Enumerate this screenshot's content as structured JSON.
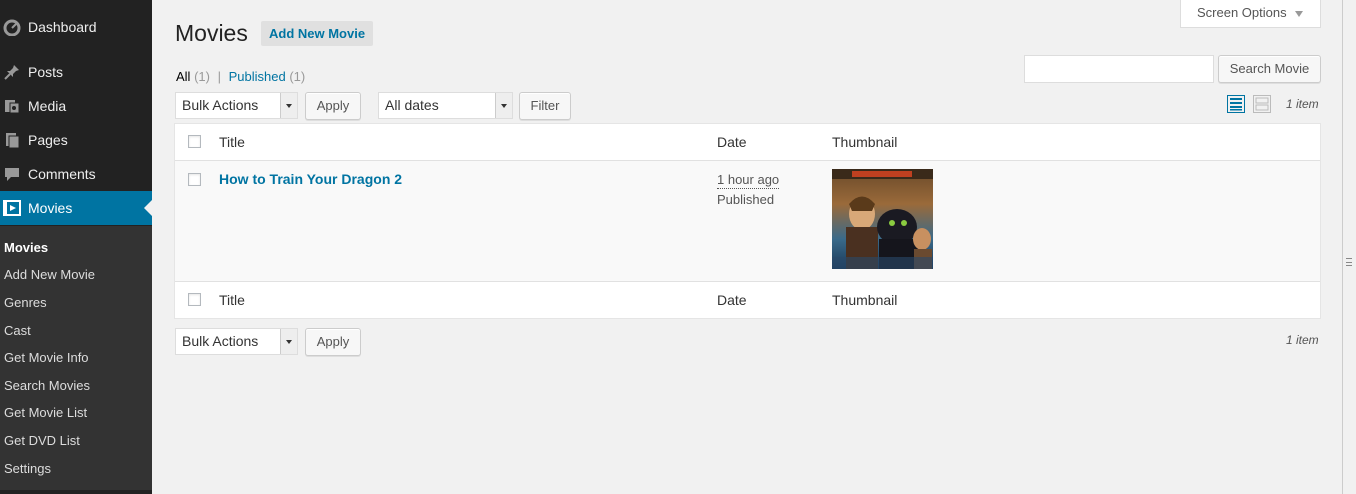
{
  "menu": {
    "items": [
      {
        "label": "Dashboard",
        "icon": "dashboard-icon"
      },
      {
        "label": "Posts",
        "icon": "pin-icon"
      },
      {
        "label": "Media",
        "icon": "media-icon"
      },
      {
        "label": "Pages",
        "icon": "pages-icon"
      },
      {
        "label": "Comments",
        "icon": "comment-icon"
      },
      {
        "label": "Movies",
        "icon": "video-icon"
      }
    ],
    "submenu": [
      "Movies",
      "Add New Movie",
      "Genres",
      "Cast",
      "Get Movie Info",
      "Search Movies",
      "Get Movie List",
      "Get DVD List",
      "Settings"
    ]
  },
  "header": {
    "title": "Movies",
    "add_new_label": "Add New Movie",
    "screen_options": "Screen Options"
  },
  "filters": {
    "all_label": "All",
    "all_count": "(1)",
    "sep": "|",
    "published_label": "Published",
    "published_count": "(1)"
  },
  "search": {
    "button": "Search Movie",
    "value": ""
  },
  "tablenav": {
    "bulk_actions": "Bulk Actions",
    "apply": "Apply",
    "dates": "All dates",
    "filter": "Filter",
    "items_count": "1 item"
  },
  "table": {
    "columns": [
      "Title",
      "Date",
      "Thumbnail"
    ],
    "rows": [
      {
        "title": "How to Train Your Dragon 2",
        "date_ago": "1 hour ago",
        "status": "Published"
      }
    ]
  },
  "colors": {
    "sidebar_bg": "#222222",
    "submenu_bg": "#333333",
    "accent": "#0074a2",
    "page_bg": "#f1f1f1"
  }
}
